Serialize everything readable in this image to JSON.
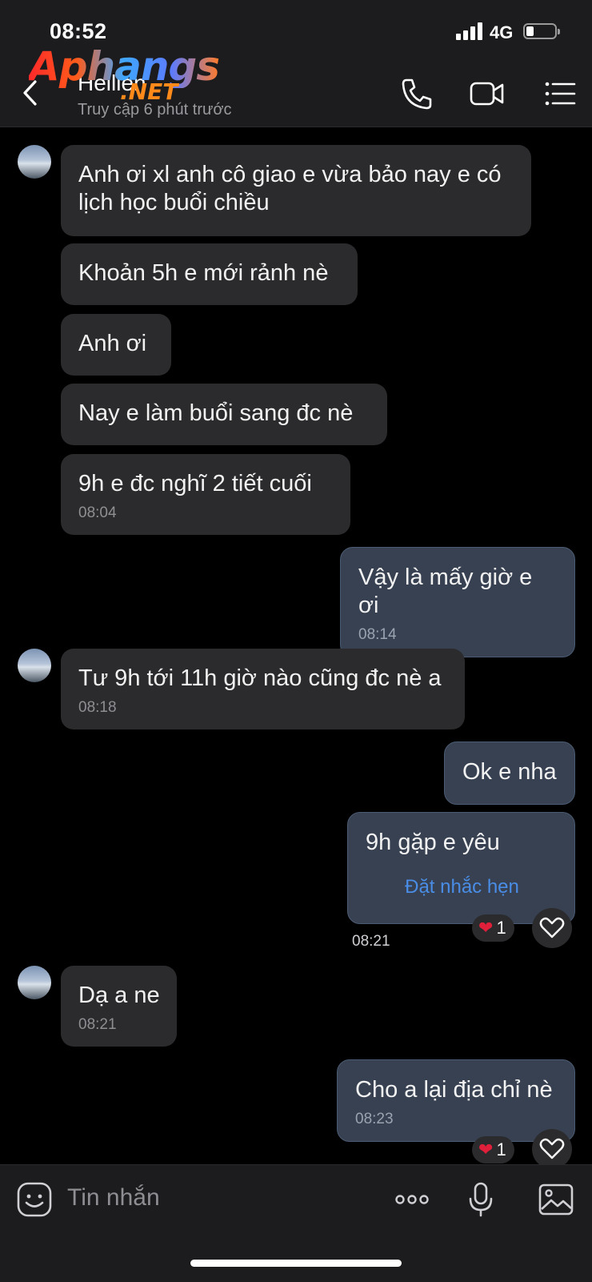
{
  "status_bar": {
    "time": "08:52",
    "network": "4G"
  },
  "header": {
    "back_icon": "chevron-left-icon",
    "contact_name": "Heilien",
    "contact_status": "Truy cập 6 phút trước",
    "actions": [
      "phone-icon",
      "video-call-icon",
      "menu-list-icon"
    ]
  },
  "watermark": {
    "main": "Aphangs",
    "sub": ".NET"
  },
  "messages": [
    {
      "side": "received",
      "text": "Anh ơi xl anh cô giao e vừa bảo nay e có lịch học buổi chiều",
      "time": ""
    },
    {
      "side": "received",
      "text": "Khoản 5h e mới rảnh nè",
      "time": ""
    },
    {
      "side": "received",
      "text": "Anh ơi",
      "time": ""
    },
    {
      "side": "received",
      "text": "Nay e làm buổi sang đc nè",
      "time": ""
    },
    {
      "side": "received",
      "text": "9h e đc nghĩ 2 tiết cuối",
      "time": "08:04"
    },
    {
      "side": "sent",
      "text": "Vậy là mấy giờ e ơi",
      "time": "08:14"
    },
    {
      "side": "received",
      "text": "Tư 9h tới 11h giờ nào cũng đc nè a",
      "time": "08:18"
    },
    {
      "side": "sent",
      "text": "Ok e nha",
      "time": ""
    },
    {
      "side": "sent",
      "text": "9h gặp e yêu",
      "time": "08:21",
      "action": "Đặt nhắc hẹn",
      "reaction": {
        "emoji": "heart",
        "count": "1"
      }
    },
    {
      "side": "received",
      "text": "Dạ a ne",
      "time": "08:21"
    },
    {
      "side": "sent",
      "text": "Cho a lại địa chỉ nè",
      "time": "08:23",
      "reaction": {
        "emoji": "heart",
        "count": "1"
      }
    }
  ],
  "composer": {
    "placeholder": "Tin nhắn",
    "icons": [
      "sticker-icon",
      "more-icon",
      "microphone-icon",
      "image-icon"
    ]
  }
}
